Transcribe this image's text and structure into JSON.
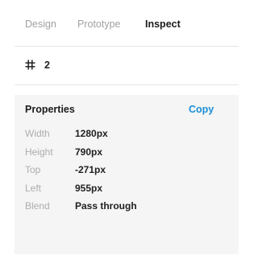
{
  "tabs": [
    {
      "label": "Design",
      "active": false
    },
    {
      "label": "Prototype",
      "active": false
    },
    {
      "label": "Inspect",
      "active": true
    }
  ],
  "layer": {
    "icon": "frame-hash-icon",
    "name": "2"
  },
  "properties": {
    "title": "Properties",
    "copy_label": "Copy",
    "rows": [
      {
        "label": "Width",
        "value": "1280px"
      },
      {
        "label": "Height",
        "value": "790px"
      },
      {
        "label": "Top",
        "value": "-271px"
      },
      {
        "label": "Left",
        "value": "955px"
      },
      {
        "label": "Blend",
        "value": "Pass through"
      }
    ]
  },
  "colors": {
    "accent": "#1e8fd6",
    "properties_background": "#f4f5f4",
    "muted_text": "#a1a1a1"
  }
}
